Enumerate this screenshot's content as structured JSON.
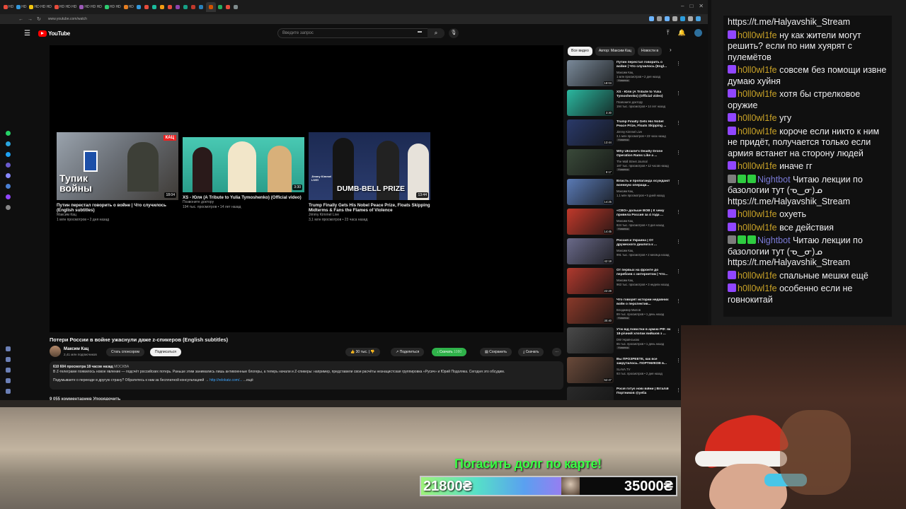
{
  "browser": {
    "tab_labels": [
      "HD",
      "HD",
      "HD HD HD",
      "HD HD HD",
      "HD HD HD",
      "HD HD",
      "HD"
    ],
    "url": "www.youtube.com/watch",
    "tab_colors": [
      "#e74c3c",
      "#3498db",
      "#f1c40f",
      "#e74c3c",
      "#9b59b6",
      "#2ecc71",
      "#e67e22",
      "#3498db",
      "#e74c3c",
      "#1abc9c",
      "#f39c12",
      "#e74c3c",
      "#8e44ad",
      "#16a085",
      "#c0392b",
      "#2980b9",
      "#d35400",
      "#27ae60",
      "#e74c3c",
      "#7f8c8d"
    ],
    "side_icon_colors": [
      "#25d366",
      "#2aa6e0",
      "#1da1f2",
      "#6a5acd",
      "#8888ff",
      "#4a7fd4",
      "#9146ff",
      "#888888"
    ],
    "ext_icon_colors": [
      "#6cb4ff",
      "#999",
      "#6cb4ff",
      "#aaa",
      "#2d9cdb",
      "#aaa",
      "#4aa3df"
    ]
  },
  "youtube": {
    "logo_text": "YouTube",
    "search_placeholder": "Введите запрос",
    "endcards": [
      {
        "title": "Путин перестал говорить о войне | Что случилось (English subtitles)",
        "channel": "Максим Кац",
        "meta": "1 млн просмотров • 2 дня назад",
        "duration": "18:04",
        "thumb_text": "Тупик войны",
        "badge": "КАЦ"
      },
      {
        "title": "XS - Юля (A Tribute to Yulia Tymoshenko) (Official video)",
        "channel": "Позвоните доктору",
        "meta": "194 тыс. просмотров • 14 лет назад",
        "duration": "3:30",
        "thumb_text": "",
        "badge": ""
      },
      {
        "title": "Trump Finally Gets His Nobel Peace Prize, Floats Skipping Midterms & Fans the Flames of Violence",
        "channel": "Jimmy Kimmel Live",
        "meta": "3,1 млн просмотров • 23 часа назад",
        "duration": "13:44",
        "thumb_text": "DUMB-BELL PRIZE",
        "badge": "Jimmy Kimmel LIVE!"
      }
    ],
    "video_title": "Потери России в войне ужаснули даже z-спикеров (English subtitles)",
    "channel_name": "Максим Кац",
    "channel_subs": "2,41 млн подписчиков",
    "sponsor_label": "Стать спонсором",
    "subscribe_label": "Подписаться",
    "like_count": "30 тыс.",
    "share_label": "Поделиться",
    "download_label": "Скачать",
    "download_extra": "1080",
    "save_label": "Сохранить",
    "download2_label": "Скачать",
    "desc_stats": "610 604 просмотра  18 часов назад",
    "desc_location": "МОСКВА",
    "desc_text": "В Z-телеграме появилось новое явление — подсчёт российских потерь. Раньше этим занимались лишь антивоенные блогеры, а теперь начали и Z-спикеры: например, представили свои расчёты незнацистская группировка «Русич» и Юрий Подоляка. Сегодня это обсудим.",
    "desc_promo": "Подумываете о переезде в другую страну? Обратитесь к нам за бесплатной консультацией →",
    "desc_link": "http://relokatz.com/...",
    "desc_more": "...ещё",
    "comments_peek": "9 055 комментариев      Упорядочить",
    "chips": [
      "Все видео",
      "Автор: Максим Кац",
      "Новости в"
    ],
    "related": [
      {
        "title": "Путин перестал говорить о войне | Что случилось (Engl...",
        "channel": "Максим Кац",
        "meta": "1 млн просмотров • 2 дня назад",
        "badge": "Новинка",
        "duration": "18:04",
        "color": "#7a8a9a"
      },
      {
        "title": "XS - Юля (A Tribute to Yulia Tymoshenko) (Official video)",
        "channel": "Позвоните доктору",
        "meta": "194 тыс. просмотров • 14 лет назад",
        "badge": "",
        "duration": "3:30",
        "color": "#2bb8a0"
      },
      {
        "title": "Trump Finally Gets His Nobel Peace Prize, Floats Skipping ...",
        "channel": "Jimmy Kimmel Live",
        "meta": "3,1 млн просмотров • 23 часа назад",
        "badge": "Новинка",
        "duration": "13:44",
        "color": "#2a3a6a"
      },
      {
        "title": "Why Ukraine's Deadly Drone Operation Rams Like a ...",
        "channel": "The Wall Street Journal",
        "meta": "187 тыс. просмотров • 12 часов назад",
        "badge": "Новинка",
        "duration": "9:17",
        "color": "#3a4a3a"
      },
      {
        "title": "Власть и пропаганда осуждают военную операци...",
        "channel": "Максим Кац",
        "meta": "1,1 млн просмотров • 5 дней назад",
        "badge": "",
        "duration": "14:25",
        "color": "#5a7ab5"
      },
      {
        "title": "«СВО» дольше ВОВ | К чему привела Россия за 4 года ...",
        "channel": "Максим Кац",
        "meta": "824 тыс. просмотров • 3 дня назад",
        "badge": "Новинка",
        "duration": "14:45",
        "color": "#c0392b"
      },
      {
        "title": "Россия и Украина | От дружеского диалога к ...",
        "channel": "Максим Кац",
        "meta": "991 тыс. просмотров • 2 месяца назад",
        "badge": "",
        "duration": "42:18",
        "color": "#6a6a8a"
      },
      {
        "title": "От первых на фронте до перебоев с интернетом | Что...",
        "channel": "Максим Кац",
        "meta": "963 тыс. просмотров • 3 недели назад",
        "badge": "",
        "duration": "22:28",
        "color": "#b03a2e"
      },
      {
        "title": "Что говорят истории недавних войн о перспектив...",
        "channel": "Владимир Милов",
        "meta": "89 тыс. просмотров • 1 день назад",
        "badge": "Новинка",
        "duration": "30:40",
        "color": "#8a3a2a"
      },
      {
        "title": "Утік від повістки в армію РФ: як 18-річний хлопак вийшов з ...",
        "channel": "DW Українською",
        "meta": "65 тыс. просмотров • 1 день назад",
        "badge": "Новинка",
        "duration": "",
        "color": "#4a4a4a"
      },
      {
        "title": "Вы ПРОЗРЕЕТЕ, как все закрутилось. ПОРТНИКОВ в...",
        "channel": "SLAVA.TV",
        "meta": "93 тыс. просмотров • 2 дня назад",
        "badge": "",
        "duration": "52:47",
        "color": "#6a4a3a"
      },
      {
        "title": "Росія готує нові війни | Віталій Портников @yelia",
        "channel": "",
        "meta": "",
        "badge": "",
        "duration": "",
        "color": "#2a2a2a"
      }
    ]
  },
  "chat": {
    "messages": [
      {
        "user": "",
        "text": "https://t.me/Halyavshik_Stream",
        "bot": false
      },
      {
        "user": "h0ll0wl1fe",
        "text": "ну как жители могут решить? если по ним хуярят с пулемётов",
        "bot": false
      },
      {
        "user": "h0ll0wl1fe",
        "text": "совсем без помощи извне думаю хуйня",
        "bot": false
      },
      {
        "user": "h0ll0wl1fe",
        "text": "хотя бы стрелковое оружие",
        "bot": false
      },
      {
        "user": "h0ll0wl1fe",
        "text": "угу",
        "bot": false
      },
      {
        "user": "h0ll0wl1fe",
        "text": "короче если никто к ним не придёт, получается только если армия встанет на сторону людей",
        "bot": false
      },
      {
        "user": "h0ll0wl1fe",
        "text": "иначе гг",
        "bot": false
      },
      {
        "user": "Nightbot",
        "text": "Читаю лекции по базологии тут (ᓀ‿ᓂ)ᓄ https://t.me/Halyavshik_Stream",
        "bot": true
      },
      {
        "user": "h0ll0wl1fe",
        "text": "охуеть",
        "bot": false
      },
      {
        "user": "h0ll0wl1fe",
        "text": "все действия",
        "bot": false
      },
      {
        "user": "Nightbot",
        "text": "Читаю лекции по базологии тут (ᓀ‿ᓂ)ᓄ https://t.me/Halyavshik_Stream",
        "bot": true
      },
      {
        "user": "h0ll0wl1fe",
        "text": "спальные мешки ещё",
        "bot": false
      },
      {
        "user": "h0ll0wl1fe",
        "text": "особенно если не говнокитай",
        "bot": false
      }
    ],
    "user_color": "#c9a227",
    "bot_color": "#7b7bd8"
  },
  "donation": {
    "title": "Погасить долг по карте!",
    "current": "21800₴",
    "goal": "35000₴",
    "progress": 0.623
  }
}
